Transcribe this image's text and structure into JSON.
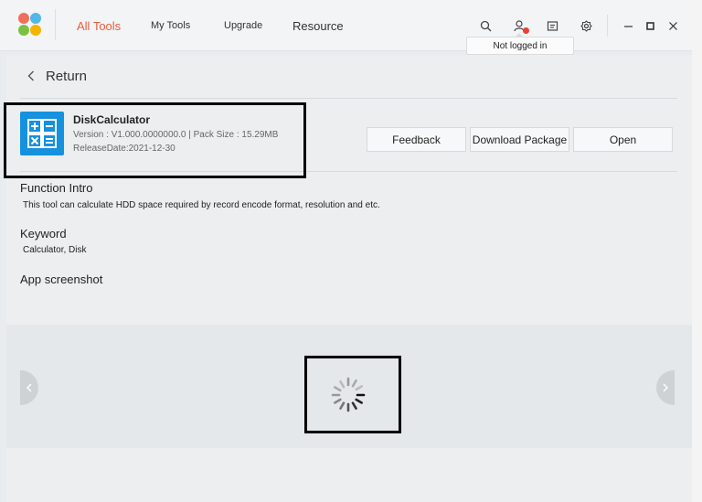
{
  "header": {
    "nav": [
      {
        "label": "All Tools"
      },
      {
        "label": "My Tools"
      },
      {
        "label": "Upgrade"
      },
      {
        "label": "Resource"
      }
    ],
    "tooltip": "Not logged in",
    "active_color": "#ef5a3c"
  },
  "page": {
    "return_label": "Return"
  },
  "app": {
    "name": "DiskCalculator",
    "version_line": "Version : V1.000.0000000.0 | Pack Size : 15.29MB",
    "release_line": "ReleaseDate:2021-12-30",
    "icon_color": "#1591de"
  },
  "actions": {
    "feedback": "Feedback",
    "download": "Download Package",
    "open": "Open"
  },
  "sections": {
    "intro_title": "Function Intro",
    "intro_text": "This tool can calculate HDD space required by record encode format, resolution and etc.",
    "keyword_title": "Keyword",
    "keyword_text": "Calculator, Disk",
    "screenshot_title": "App screenshot"
  },
  "icons": {
    "logo": "app-logo",
    "search": "search-icon",
    "user": "user-icon",
    "notes": "notes-icon",
    "settings": "gear-icon",
    "loading": "loading-spinner-icon"
  }
}
